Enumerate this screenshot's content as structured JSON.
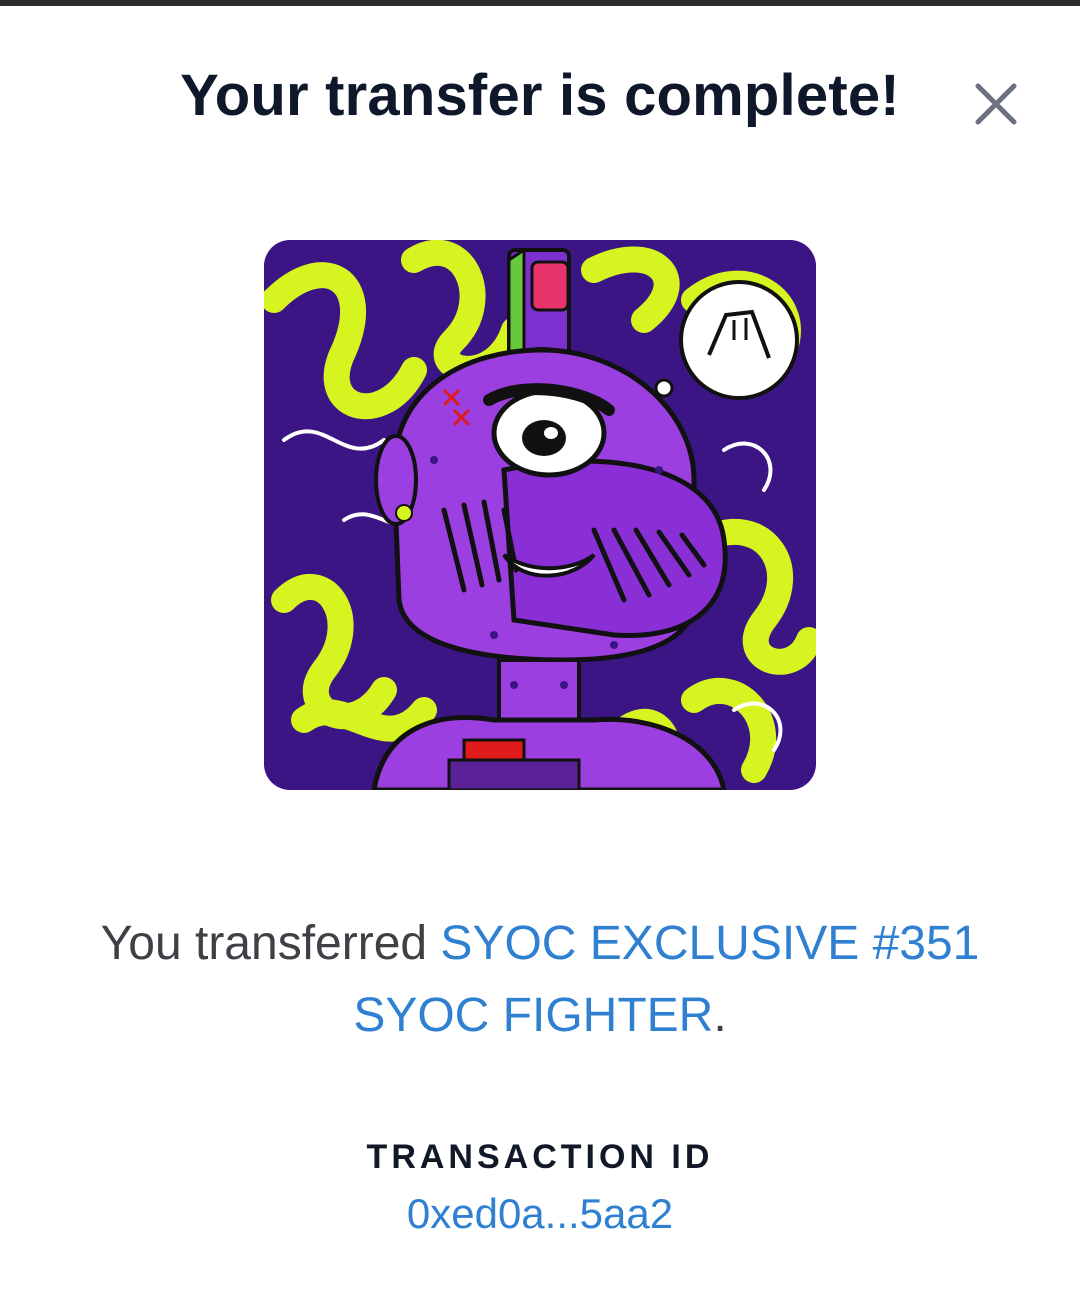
{
  "modal": {
    "title": "Your transfer is complete!",
    "close_icon": "close-icon",
    "image": {
      "icon": "nft-artwork",
      "background_color": "#3c1585",
      "accent_color": "#d6f520",
      "character_color": "#9b3fe0"
    },
    "message": {
      "prefix": "You transferred ",
      "item_name": "SYOC EXCLUSIVE #351",
      "collection_name": "SYOC FIGHTER",
      "suffix": "."
    },
    "transaction": {
      "label": "TRANSACTION ID",
      "id": "0xed0a...5aa2"
    },
    "colors": {
      "link": "#2f80d1",
      "title": "#0f172a",
      "text": "#3f3f46"
    }
  }
}
